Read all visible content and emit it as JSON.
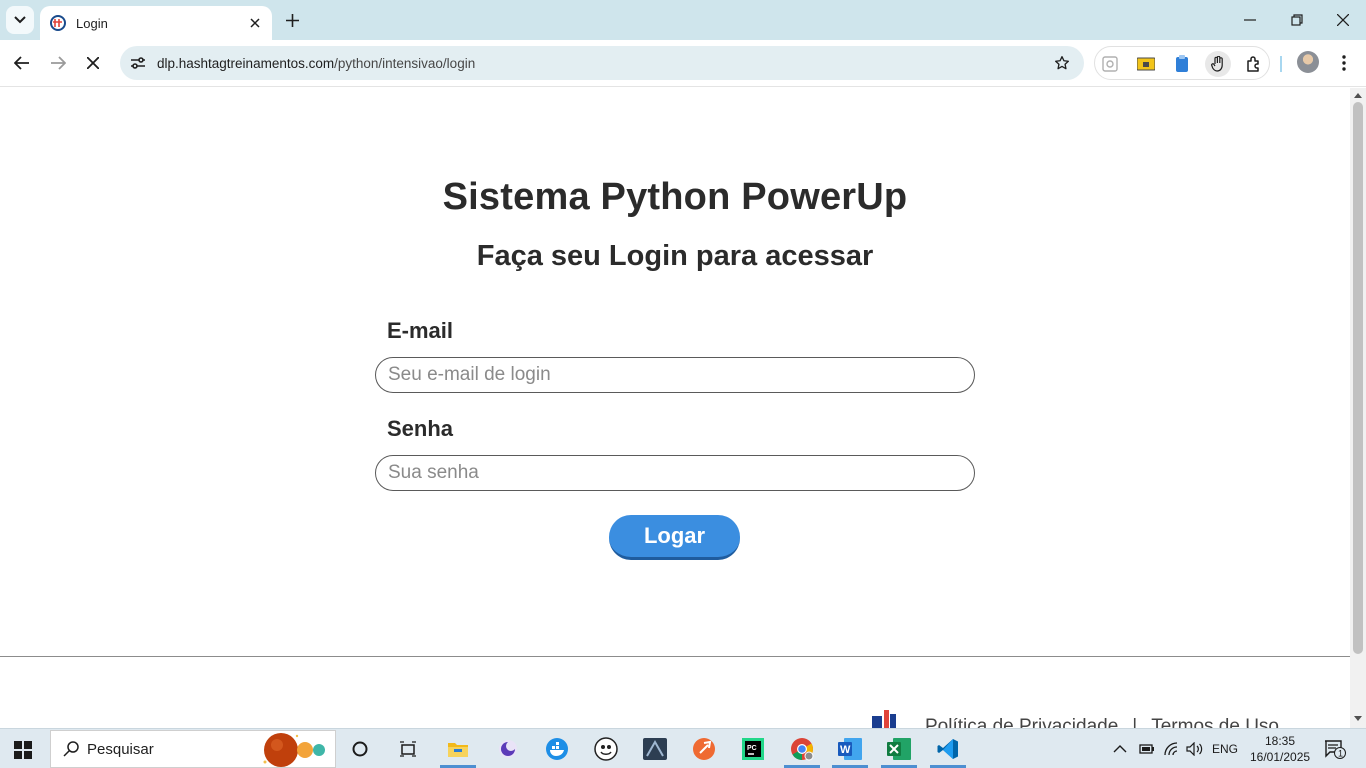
{
  "browser": {
    "tab": {
      "title": "Login"
    },
    "address_bar": {
      "host": "dlp.hashtagtreinamentos.com",
      "path": "/python/intensivao/login"
    }
  },
  "page": {
    "title": "Sistema Python PowerUp",
    "subtitle": "Faça seu Login para acessar",
    "email": {
      "label": "E-mail",
      "placeholder": "Seu e-mail de login",
      "value": ""
    },
    "password": {
      "label": "Senha",
      "placeholder": "Sua senha",
      "value": ""
    },
    "login_button": "Logar",
    "footer": {
      "privacy": "Política de Privacidade",
      "separator": "|",
      "terms": "Termos de Uso"
    }
  },
  "taskbar": {
    "search_label": "Pesquisar",
    "language": "ENG",
    "time": "18:35",
    "date": "16/01/2025",
    "notification_count": "1"
  },
  "colors": {
    "accent_button": "#3b8ee0",
    "tabbar_bg": "#cfe5ec",
    "omnibox_bg": "#e3eef2",
    "taskbar_bg": "#dfe9f0"
  }
}
